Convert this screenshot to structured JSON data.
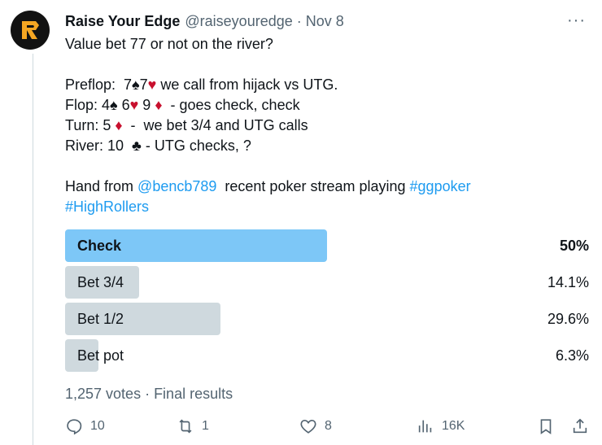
{
  "author": {
    "name": "Raise Your Edge",
    "handle": "@raiseyouredge",
    "separator": "·",
    "date": "Nov 8",
    "avatar_letter": "R",
    "avatar_colors": {
      "bg": "#121212",
      "accent": "#f5a623"
    }
  },
  "more_icon": "···",
  "tweet": {
    "line1": "Value bet 77 or not on the river?",
    "preflop": {
      "a": "Preflop:  7",
      "s1": "♠",
      "b": "7",
      "s2": "♥",
      "c": " we call from hijack vs UTG."
    },
    "flop": {
      "a": "Flop: 4",
      "s1": "♠",
      "b": " 6",
      "s2": "♥",
      "c": " 9 ",
      "s3": "♦",
      "d": "  - goes check, check"
    },
    "turn": {
      "a": "Turn: 5 ",
      "s1": "♦",
      "b": "  -  we bet 3/4 and UTG calls"
    },
    "river": {
      "a": "River: 10  ",
      "s1": "♣",
      "b": " - UTG checks, ?"
    },
    "hand": {
      "a": "Hand from ",
      "mention": "@bencb789",
      "b": "  recent poker stream playing ",
      "tag1": "#ggpoker"
    },
    "tag2": "#HighRollers"
  },
  "poll": {
    "options": [
      {
        "label": "Check",
        "percent_text": "50%",
        "fraction": 0.5,
        "winner": true
      },
      {
        "label": "Bet 3/4",
        "percent_text": "14.1%",
        "fraction": 0.141,
        "winner": false
      },
      {
        "label": "Bet 1/2",
        "percent_text": "29.6%",
        "fraction": 0.296,
        "winner": false
      },
      {
        "label": "Bet pot",
        "percent_text": "6.3%",
        "fraction": 0.063,
        "winner": false
      }
    ],
    "summary": "1,257 votes · Final results"
  },
  "actions": {
    "reply": {
      "icon": "reply-icon",
      "count": "10"
    },
    "retweet": {
      "icon": "retweet-icon",
      "count": "1"
    },
    "like": {
      "icon": "heart-icon",
      "count": "8"
    },
    "views": {
      "icon": "views-icon",
      "count": "16K"
    },
    "bookmark": {
      "icon": "bookmark-icon"
    },
    "share": {
      "icon": "share-icon"
    }
  },
  "colors": {
    "link": "#1d9bf0",
    "poll_winner": "#7dc7f7",
    "poll_other": "#cfd9de",
    "suit_red": "#c8102e",
    "muted": "#536471"
  }
}
